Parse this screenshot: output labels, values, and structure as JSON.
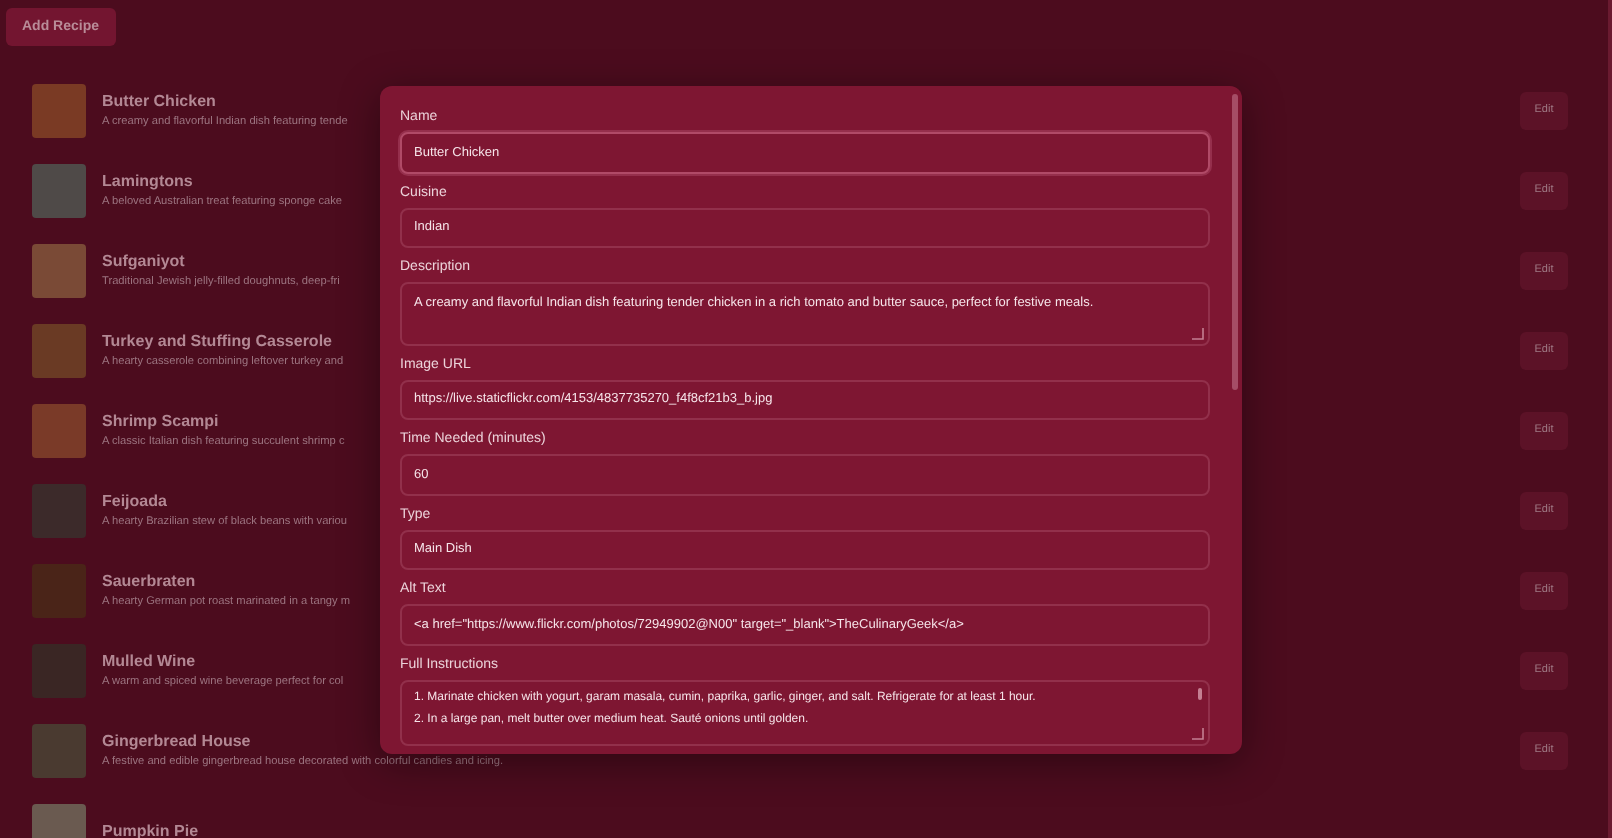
{
  "add_button": {
    "label": "Add Recipe"
  },
  "recipes": [
    {
      "name": "Butter Chicken",
      "description": "A creamy and flavorful Indian dish featuring tende",
      "edit": "Edit"
    },
    {
      "name": "Lamingtons",
      "description": "A beloved Australian treat featuring sponge cake",
      "edit": "Edit"
    },
    {
      "name": "Sufganiyot",
      "description": "Traditional Jewish jelly-filled doughnuts, deep-fri",
      "edit": "Edit"
    },
    {
      "name": "Turkey and Stuffing Casserole",
      "description": "A hearty casserole combining leftover turkey and",
      "edit": "Edit"
    },
    {
      "name": "Shrimp Scampi",
      "description": "A classic Italian dish featuring succulent shrimp c",
      "edit": "Edit"
    },
    {
      "name": "Feijoada",
      "description": "A hearty Brazilian stew of black beans with variou",
      "edit": "Edit"
    },
    {
      "name": "Sauerbraten",
      "description": "A hearty German pot roast marinated in a tangy m",
      "edit": "Edit"
    },
    {
      "name": "Mulled Wine",
      "description": "A warm and spiced wine beverage perfect for col",
      "edit": "Edit"
    },
    {
      "name": "Gingerbread House",
      "description": "A festive and edible gingerbread house decorated with colorful candies and icing.",
      "edit": "Edit"
    },
    {
      "name": "Pumpkin Pie"
    }
  ],
  "form": {
    "fields": [
      {
        "kind": "input",
        "label": "Name",
        "value": "Butter Chicken",
        "focused": true
      },
      {
        "kind": "input",
        "label": "Cuisine",
        "value": "Indian",
        "focused": false
      },
      {
        "kind": "textarea",
        "label": "Description",
        "value": "A creamy and flavorful Indian dish featuring tender chicken in a rich tomato and butter sauce, perfect for festive meals.",
        "focused": false
      },
      {
        "kind": "input",
        "label": "Image URL",
        "value": "https://live.staticflickr.com/4153/4837735270_f4f8cf21b3_b.jpg",
        "focused": false
      },
      {
        "kind": "input",
        "label": "Time Needed (minutes)",
        "value": "60",
        "focused": false
      },
      {
        "kind": "input",
        "label": "Type",
        "value": "Main Dish",
        "focused": false
      },
      {
        "kind": "input",
        "label": "Alt Text",
        "value": "<a href=\"https://www.flickr.com/photos/72949902@N00\" target=\"_blank\">TheCulinaryGeek</a>",
        "focused": false
      },
      {
        "kind": "lines",
        "label": "Full Instructions",
        "lines": [
          "1. Marinate chicken with yogurt, garam masala, cumin, paprika, garlic, ginger, and salt. Refrigerate for at least 1 hour.",
          "2. In a large pan, melt butter over medium heat. Sauté onions until golden."
        ],
        "focused": false
      }
    ]
  }
}
